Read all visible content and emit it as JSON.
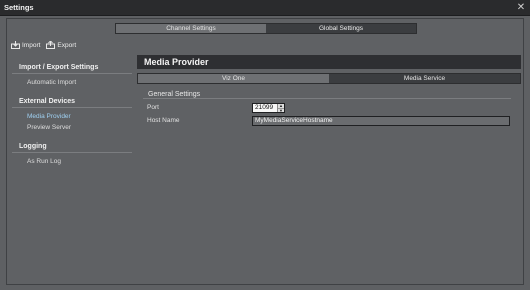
{
  "window": {
    "title": "Settings"
  },
  "top_tabs": [
    {
      "label": "Channel Settings",
      "active": false
    },
    {
      "label": "Global Settings",
      "active": true
    }
  ],
  "toolbar": {
    "import_label": "Import",
    "export_label": "Export"
  },
  "sidebar": {
    "sections": [
      {
        "header": "Import / Export Settings",
        "items": [
          "Automatic Import"
        ]
      },
      {
        "header": "External Devices",
        "items": [
          "Media Provider",
          "Preview Server"
        ]
      },
      {
        "header": "Logging",
        "items": [
          "As Run Log"
        ]
      }
    ],
    "selected_item": "Media Provider"
  },
  "content": {
    "title": "Media Provider",
    "sub_tabs": [
      {
        "label": "Viz One",
        "active": false
      },
      {
        "label": "Media Service",
        "active": true
      }
    ],
    "group_title": "General Settings",
    "port_label": "Port",
    "port_value": "21099",
    "host_label": "Host Name",
    "host_value": "MyMediaServiceHostname"
  },
  "colors": {
    "background": "#5e6063",
    "titlebar": "#2a2b2d",
    "header_bar": "#2e2f32",
    "selected_item": "#9fd0f2"
  }
}
